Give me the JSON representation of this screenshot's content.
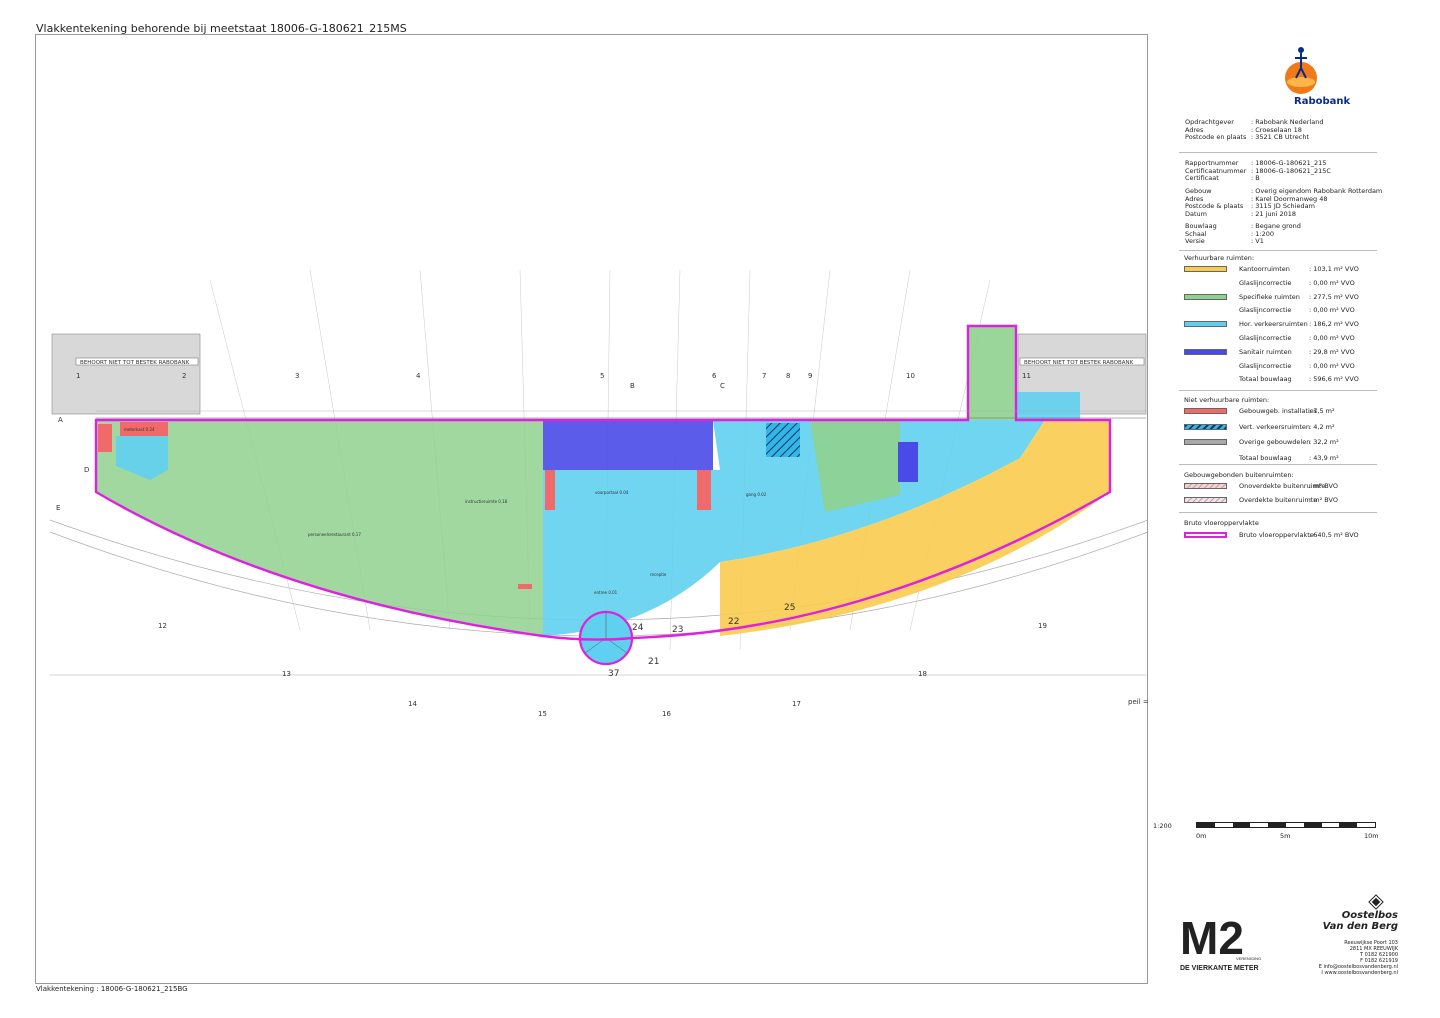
{
  "header": {
    "title": "Vlakkentekening behorende bij meetstaat 18006-G-180621_215MS"
  },
  "footer": {
    "text": "Vlakkentekening : 18006-G-180621_215BG"
  },
  "client_logo": {
    "name": "Rabobank",
    "icon": "rabobank-logo-icon",
    "color": "#0a2a8c"
  },
  "client_info": [
    {
      "label": "Opdrachtgever",
      "value": ": Rabobank Nederland"
    },
    {
      "label": "Adres",
      "value": ": Croeselaan 18"
    },
    {
      "label": "Postcode en plaats",
      "value": ": 3521 CB Utrecht"
    }
  ],
  "report_info": [
    {
      "label": "Rapportnummer",
      "value": ": 18006-G-180621_215"
    },
    {
      "label": "Certificaatnummer",
      "value": ": 18006-G-180621_215C"
    },
    {
      "label": "Certificaat",
      "value": ": B"
    }
  ],
  "building_info": [
    {
      "label": "Gebouw",
      "value": ": Overig eigendom Rabobank Rotterdam"
    },
    {
      "label": "Adres",
      "value": ": Karel Doormanweg 48"
    },
    {
      "label": "Postcode & plaats",
      "value": ": 3115 JD Schiedam"
    },
    {
      "label": "Datum",
      "value": ": 21 juni 2018"
    }
  ],
  "floor_info": [
    {
      "label": "Bouwlaag",
      "value": ": Begane grond"
    },
    {
      "label": "Schaal",
      "value": ": 1:200"
    },
    {
      "label": "Versie",
      "value": ": V1"
    }
  ],
  "legend": {
    "rentable_title": "Verhuurbare ruimten:",
    "rentable": [
      {
        "label": "Kantoorruimten",
        "value": ": 103,1 m² VVO",
        "color": "#f9cc4f"
      },
      {
        "label": "Glaslijncorrectie",
        "value": ": 0,00 m² VVO",
        "color": ""
      },
      {
        "label": "Specifieke ruimten",
        "value": ": 277,5 m² VVO",
        "color": "#8fd18f"
      },
      {
        "label": "Glaslijncorrectie",
        "value": ": 0,00 m² VVO",
        "color": ""
      },
      {
        "label": "Hor. verkeersruimten",
        "value": ": 186,2 m² VVO",
        "color": "#5fd0f0"
      },
      {
        "label": "Glaslijncorrectie",
        "value": ": 0,00 m² VVO",
        "color": ""
      },
      {
        "label": "Sanitair ruimten",
        "value": ": 29,8 m² VVO",
        "color": "#4a4ae8"
      },
      {
        "label": "Glaslijncorrectie",
        "value": ": 0,00 m² VVO",
        "color": ""
      },
      {
        "label": "Totaal bouwlaag",
        "value": ": 596,6 m² VVO",
        "color": ""
      }
    ],
    "nonrentable_title": "Niet verhuurbare ruimten:",
    "nonrentable": [
      {
        "label": "Gebouwgeb. installaties",
        "value": ": 7,5 m²",
        "color": "#f06a6a"
      },
      {
        "label": "Vert. verkeersruimten",
        "value": ": 4,2 m²",
        "color": "#33b5e5"
      },
      {
        "label": "Overige gebouwdelen",
        "value": ": 32,2 m²",
        "color": "#a8a8a8"
      },
      {
        "label": "Totaal bouwlaag",
        "value": ": 43,9 m²",
        "color": ""
      }
    ],
    "outdoor_title": "Gebouwgebonden buitenruimten:",
    "outdoor": [
      {
        "label": "Onoverdekte buitenruimte",
        "value": ": m² BVO",
        "color": "#f3d3d3"
      },
      {
        "label": "Overdekte buitenruimte",
        "value": ": m² BVO",
        "color": "#efe3ef"
      }
    ],
    "gross_title": "Bruto vloeroppervlakte",
    "gross": [
      {
        "label": "Bruto vloeroppervlakte",
        "value": ": 640,5 m² BVO",
        "color": "#e020e0"
      }
    ]
  },
  "scale": {
    "label": "1:200",
    "ticks": [
      "0m",
      "5m",
      "10m"
    ]
  },
  "plan": {
    "neighbor_label": "BEHOORT NIET TOT BESTEK RABOBANK",
    "room_labels": [
      "meterkast 0.24",
      "personeelsrestaurant 0.17",
      "instructieruimte 0.18",
      "voorportaal 0.04",
      "entree 0.01",
      "gang 0.02",
      "receptie"
    ],
    "grid_numbers": [
      "1",
      "2",
      "3",
      "4",
      "5",
      "6",
      "7",
      "8",
      "9",
      "10",
      "11",
      "12",
      "13",
      "14",
      "15",
      "16",
      "17",
      "18",
      "19",
      "21",
      "22",
      "23",
      "24",
      "25",
      "37"
    ],
    "axis_letters": [
      "A",
      "B",
      "C",
      "D",
      "E"
    ],
    "peil": "peil ="
  },
  "m2_logo": {
    "big": "M2",
    "top": "VERENIGING",
    "bottom": "DE VIERKANTE METER"
  },
  "company": {
    "name_line1": "Oostelbos",
    "name_line2": "Van den Berg",
    "address": [
      "Reeuwijkse Poort 103",
      "2811 MX  REEUWIJK",
      "T 0182 621900",
      "F 0182 621919",
      "E info@oostelbosvandenberg.nl",
      "I www.oostelbosvandenberg.nl"
    ]
  }
}
